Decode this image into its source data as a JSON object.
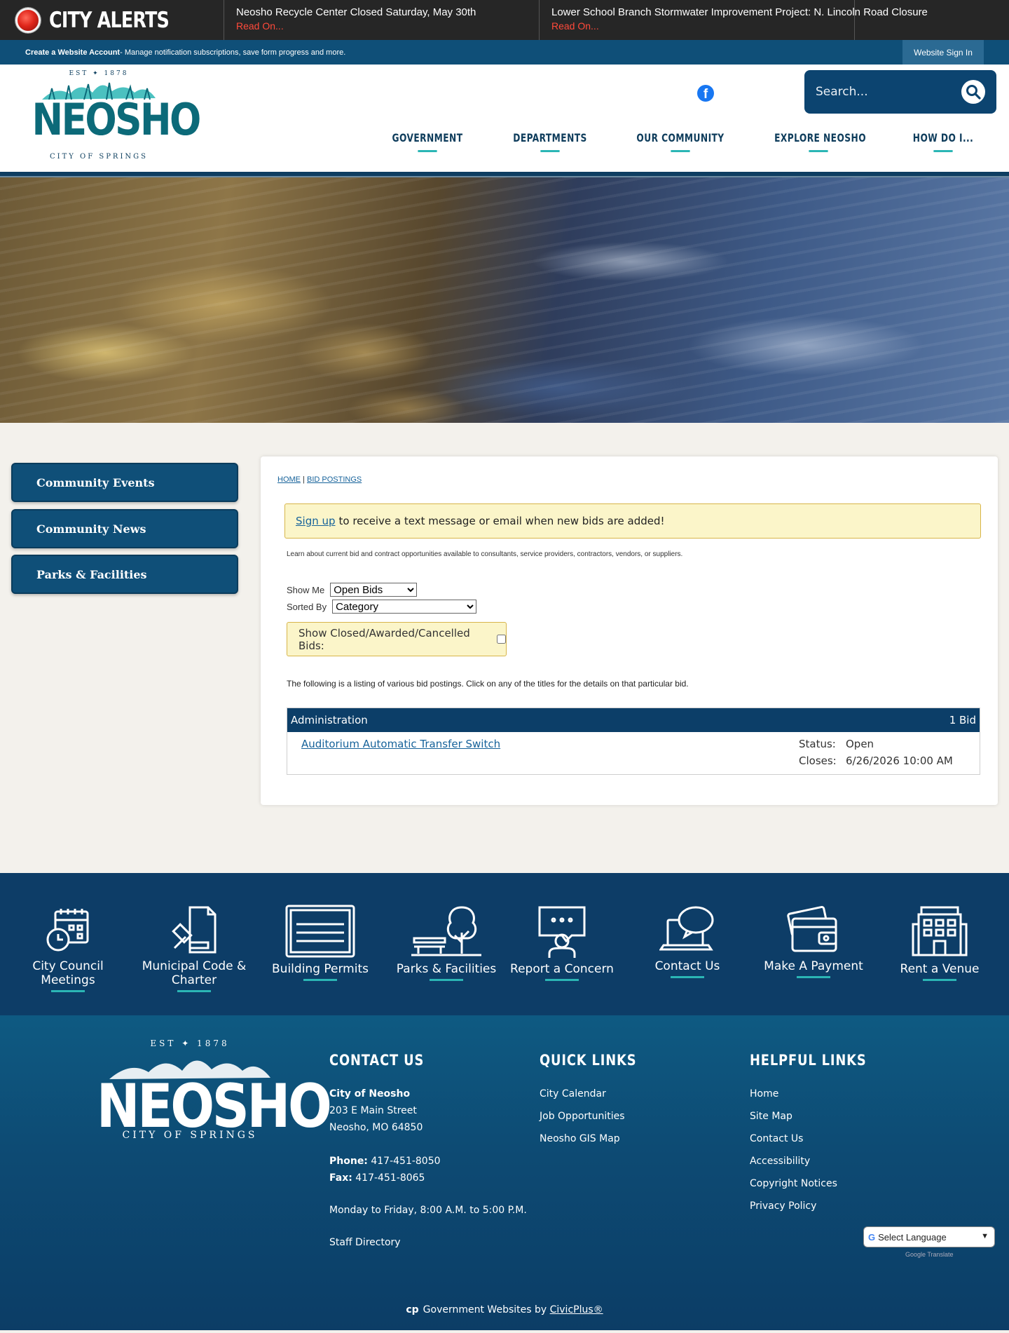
{
  "alerts": {
    "title": "CITY ALERTS",
    "items": [
      {
        "title": "Neosho Recycle Center Closed Saturday, May 30th",
        "more": "Read On..."
      },
      {
        "title": "Lower School Branch Stormwater Improvement Project: N. Lincoln Road Closure",
        "more": "Read On..."
      }
    ]
  },
  "account": {
    "create_label": "Create a Website Account",
    "create_desc": " - Manage notification subscriptions, save form progress and more.",
    "signin_label": "Website Sign In"
  },
  "logo": {
    "est": "EST ✦ 1878",
    "name": "NEOSHO",
    "sub": "CITY OF SPRINGS"
  },
  "search": {
    "placeholder": "Search..."
  },
  "nav": [
    "GOVERNMENT",
    "DEPARTMENTS",
    "OUR COMMUNITY",
    "EXPLORE NEOSHO",
    "HOW DO I..."
  ],
  "sidebar": [
    "Community Events",
    "Community News",
    "Parks & Facilities"
  ],
  "main": {
    "breadcrumb": {
      "home": "HOME",
      "sep": "|",
      "current": "BID POSTINGS"
    },
    "signup": {
      "link": "Sign up",
      "text": "to receive a text message or email when new bids are added!"
    },
    "intro": "Learn about current bid and contract opportunities available to consultants, service providers, contractors, vendors, or suppliers.",
    "show_me": {
      "label": "Show Me",
      "value": "Open Bids"
    },
    "sorted_by": {
      "label": "Sorted By",
      "value": "Category"
    },
    "show_closed": {
      "label": "Show Closed/Awarded/Cancelled Bids:",
      "checked": false
    },
    "listing_note": "The following is a listing of various bid postings. Click on any of the titles for the details on that particular bid.",
    "category": {
      "name": "Administration",
      "count": "1 Bid"
    },
    "bids": [
      {
        "title": "Auditorium Automatic Transfer Switch",
        "status_label": "Status:",
        "status": "Open",
        "closes_label": "Closes:",
        "closes": "6/26/2026 10:00 AM"
      }
    ]
  },
  "quick_links": [
    {
      "label": "City Council Meetings",
      "icon": "calendar-clock-icon"
    },
    {
      "label": "Municipal Code & Charter",
      "icon": "gavel-document-icon"
    },
    {
      "label": "Building Permits",
      "icon": "building-permit-icon"
    },
    {
      "label": "Parks & Facilities",
      "icon": "tree-bench-icon"
    },
    {
      "label": "Report a Concern",
      "icon": "person-speech-icon"
    },
    {
      "label": "Contact Us",
      "icon": "laptop-chat-icon"
    },
    {
      "label": "Make A Payment",
      "icon": "wallet-card-icon"
    },
    {
      "label": "Rent a Venue",
      "icon": "building-icon"
    }
  ],
  "footer": {
    "logo": {
      "est": "EST ✦ 1878",
      "name": "NEOSHO",
      "sub": "CITY OF SPRINGS"
    },
    "contact": {
      "heading": "CONTACT US",
      "org": "City of Neosho",
      "address1": "203 E Main Street",
      "address2": "Neosho, MO 64850",
      "phone_label": "Phone:",
      "phone": " 417-451-8050",
      "fax_label": "Fax:",
      "fax": " 417-451-8065",
      "hours": "Monday to Friday, 8:00 A.M. to 5:00 P.M.",
      "staff": "Staff Directory"
    },
    "quick": {
      "heading": "QUICK LINKS",
      "links": [
        "City Calendar",
        "Job Opportunities",
        "Neosho GIS Map"
      ]
    },
    "helpful": {
      "heading": "HELPFUL LINKS",
      "links": [
        "Home",
        "Site Map",
        "Contact Us",
        "Accessibility",
        "Copyright Notices",
        "Privacy Policy"
      ]
    },
    "translate": "Select Language",
    "powered": "Google Translate",
    "civic_prefix": "Government Websites by ",
    "civic_link": "CivicPlus®"
  },
  "colors": {
    "navy": "#0c3e68",
    "teal_accent": "#2bb6b5",
    "alert_red": "#ff4a3a"
  }
}
